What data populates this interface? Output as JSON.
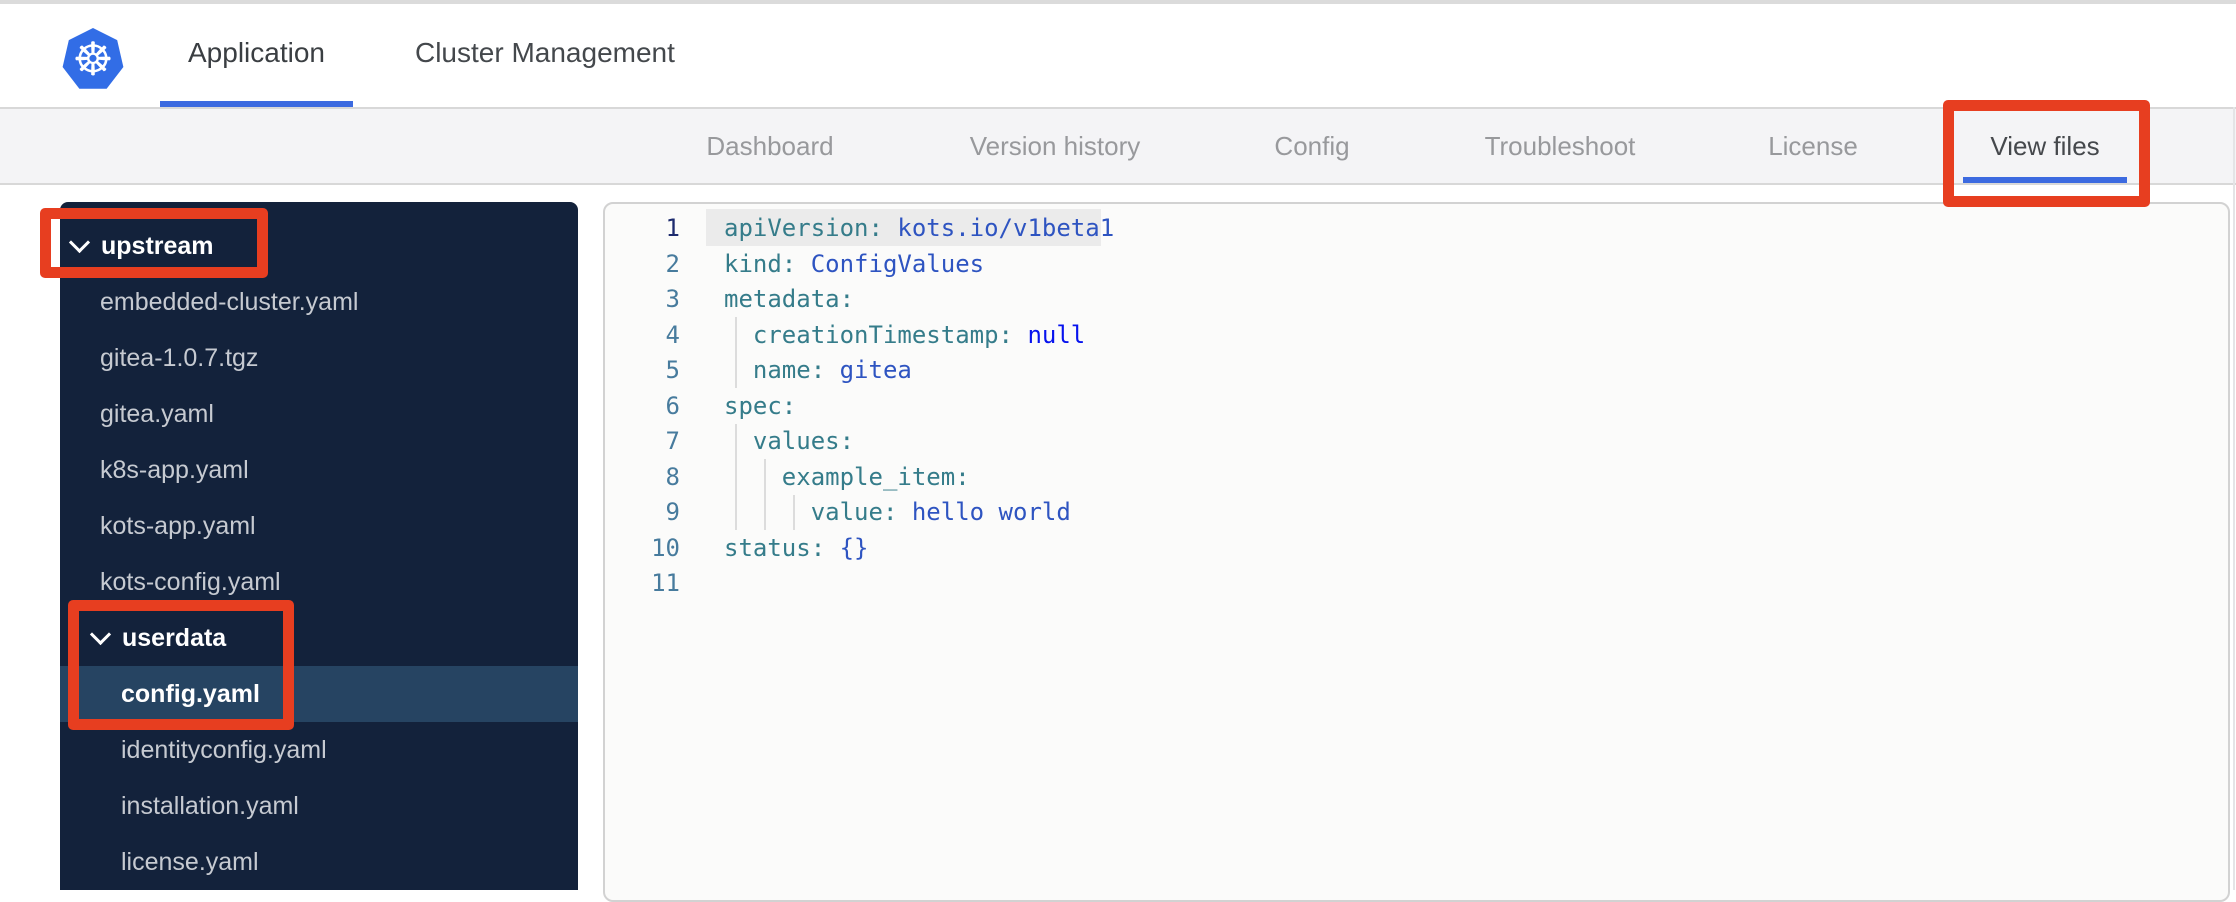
{
  "header": {
    "tabs": [
      {
        "label": "Application",
        "active": true
      },
      {
        "label": "Cluster Management",
        "active": false
      }
    ]
  },
  "subnav": {
    "items": [
      {
        "label": "Dashboard",
        "active": false
      },
      {
        "label": "Version history",
        "active": false
      },
      {
        "label": "Config",
        "active": false
      },
      {
        "label": "Troubleshoot",
        "active": false
      },
      {
        "label": "License",
        "active": false
      },
      {
        "label": "View files",
        "active": true
      }
    ]
  },
  "file_tree": {
    "items": [
      {
        "label": "upstream",
        "type": "folder",
        "level": 0,
        "expanded": true
      },
      {
        "label": "embedded-cluster.yaml",
        "type": "file",
        "level": 1
      },
      {
        "label": "gitea-1.0.7.tgz",
        "type": "file",
        "level": 1
      },
      {
        "label": "gitea.yaml",
        "type": "file",
        "level": 1
      },
      {
        "label": "k8s-app.yaml",
        "type": "file",
        "level": 1
      },
      {
        "label": "kots-app.yaml",
        "type": "file",
        "level": 1
      },
      {
        "label": "kots-config.yaml",
        "type": "file",
        "level": 1
      },
      {
        "label": "userdata",
        "type": "folder",
        "level": 1,
        "expanded": true
      },
      {
        "label": "config.yaml",
        "type": "file",
        "level": 2,
        "selected": true
      },
      {
        "label": "identityconfig.yaml",
        "type": "file",
        "level": 2
      },
      {
        "label": "installation.yaml",
        "type": "file",
        "level": 2
      },
      {
        "label": "license.yaml",
        "type": "file",
        "level": 2
      }
    ]
  },
  "editor": {
    "language": "yaml",
    "active_line": 1,
    "lines": [
      {
        "num": 1,
        "tokens": [
          [
            "key",
            "apiVersion"
          ],
          [
            "punc",
            ": "
          ],
          [
            "val",
            "kots.io/v1beta1"
          ]
        ]
      },
      {
        "num": 2,
        "tokens": [
          [
            "key",
            "kind"
          ],
          [
            "punc",
            ": "
          ],
          [
            "val",
            "ConfigValues"
          ]
        ]
      },
      {
        "num": 3,
        "tokens": [
          [
            "key",
            "metadata"
          ],
          [
            "punc",
            ":"
          ]
        ]
      },
      {
        "num": 4,
        "tokens": [
          [
            "ws",
            "  "
          ],
          [
            "key",
            "creationTimestamp"
          ],
          [
            "punc",
            ": "
          ],
          [
            "const",
            "null"
          ]
        ]
      },
      {
        "num": 5,
        "tokens": [
          [
            "ws",
            "  "
          ],
          [
            "key",
            "name"
          ],
          [
            "punc",
            ": "
          ],
          [
            "val",
            "gitea"
          ]
        ]
      },
      {
        "num": 6,
        "tokens": [
          [
            "key",
            "spec"
          ],
          [
            "punc",
            ":"
          ]
        ]
      },
      {
        "num": 7,
        "tokens": [
          [
            "ws",
            "  "
          ],
          [
            "key",
            "values"
          ],
          [
            "punc",
            ":"
          ]
        ]
      },
      {
        "num": 8,
        "tokens": [
          [
            "ws",
            "    "
          ],
          [
            "key",
            "example_item"
          ],
          [
            "punc",
            ":"
          ]
        ]
      },
      {
        "num": 9,
        "tokens": [
          [
            "ws",
            "      "
          ],
          [
            "key",
            "value"
          ],
          [
            "punc",
            ": "
          ],
          [
            "val",
            "hello world"
          ]
        ]
      },
      {
        "num": 10,
        "tokens": [
          [
            "key",
            "status"
          ],
          [
            "punc",
            ": "
          ],
          [
            "val",
            "{}"
          ]
        ]
      },
      {
        "num": 11,
        "tokens": []
      }
    ]
  },
  "annotations": {
    "color": "#e73e20",
    "highlighted": [
      "upstream",
      "userdata",
      "config.yaml",
      "View files"
    ]
  },
  "colors": {
    "brand_blue": "#326de6",
    "accent_underline": "#3c6ae0",
    "sidebar_bg": "#13223b",
    "sidebar_selected_bg": "#264462",
    "code_key": "#357c8a",
    "code_value": "#2e54c1",
    "code_constant": "#0713ee",
    "line_number": "#477b9d"
  },
  "icons": {
    "logo": "kubernetes-helm-icon",
    "folder_chevron": "chevron-down-icon"
  }
}
